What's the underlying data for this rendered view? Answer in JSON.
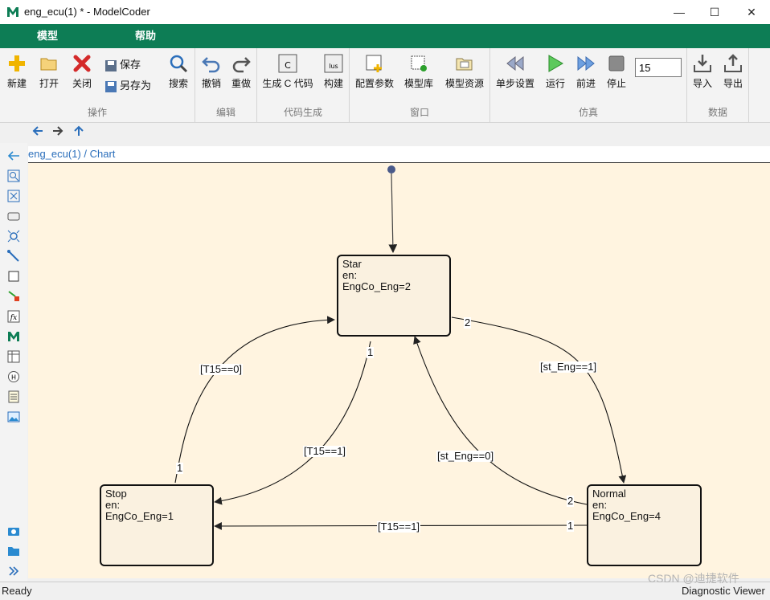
{
  "window": {
    "title": "eng_ecu(1) * - ModelCoder",
    "minimize": "—",
    "maximize": "☐",
    "close": "✕"
  },
  "menu": {
    "model": "模型",
    "help": "帮助"
  },
  "toolbar": {
    "groups": {
      "operations": "操作",
      "edit": "编辑",
      "codegen": "代码生成",
      "window": "窗口",
      "simulation": "仿真",
      "data": "数据"
    },
    "new": "新建",
    "open": "打开",
    "close": "关闭",
    "save": "保存",
    "save_as": "另存为",
    "search": "搜索",
    "undo": "撤销",
    "redo": "重做",
    "gen_c": "生成 C 代码",
    "build": "构建",
    "config": "配置参数",
    "model_lib": "模型库",
    "model_res": "模型资源",
    "step_setup": "单步设置",
    "run": "运行",
    "step_forward": "前进",
    "stop": "停止",
    "step_value": "15",
    "import": "导入",
    "export": "导出"
  },
  "breadcrumb": {
    "root": "eng_ecu(1)",
    "sep": " / ",
    "chart": "Chart"
  },
  "states": {
    "star": {
      "name": "Star",
      "en": "en:",
      "action": "EngCo_Eng=2"
    },
    "stop": {
      "name": "Stop",
      "en": "en:",
      "action": "EngCo_Eng=1"
    },
    "normal": {
      "name": "Normal",
      "en": "en:",
      "action": "EngCo_Eng=4"
    }
  },
  "transitions": {
    "stop_to_star": "[T15==0]",
    "star_to_stop": "[T15==1]",
    "star_to_normal": "[st_Eng==1]",
    "normal_to_star": "[st_Eng==0]",
    "normal_to_stop": "[T15==1]",
    "prio_star_stop": "1",
    "prio_star_normal": "2",
    "prio_stop_star": "1",
    "prio_normal_star": "2",
    "prio_normal_stop": "1"
  },
  "status": {
    "left": "Ready",
    "right": "Diagnostic Viewer",
    "watermark": "CSDN @迪捷软件"
  },
  "colors": {
    "menubar": "#0d7d55",
    "canvas": "#fff4e0",
    "state_fill": "#faf1e0",
    "link": "#2a6ebb"
  }
}
